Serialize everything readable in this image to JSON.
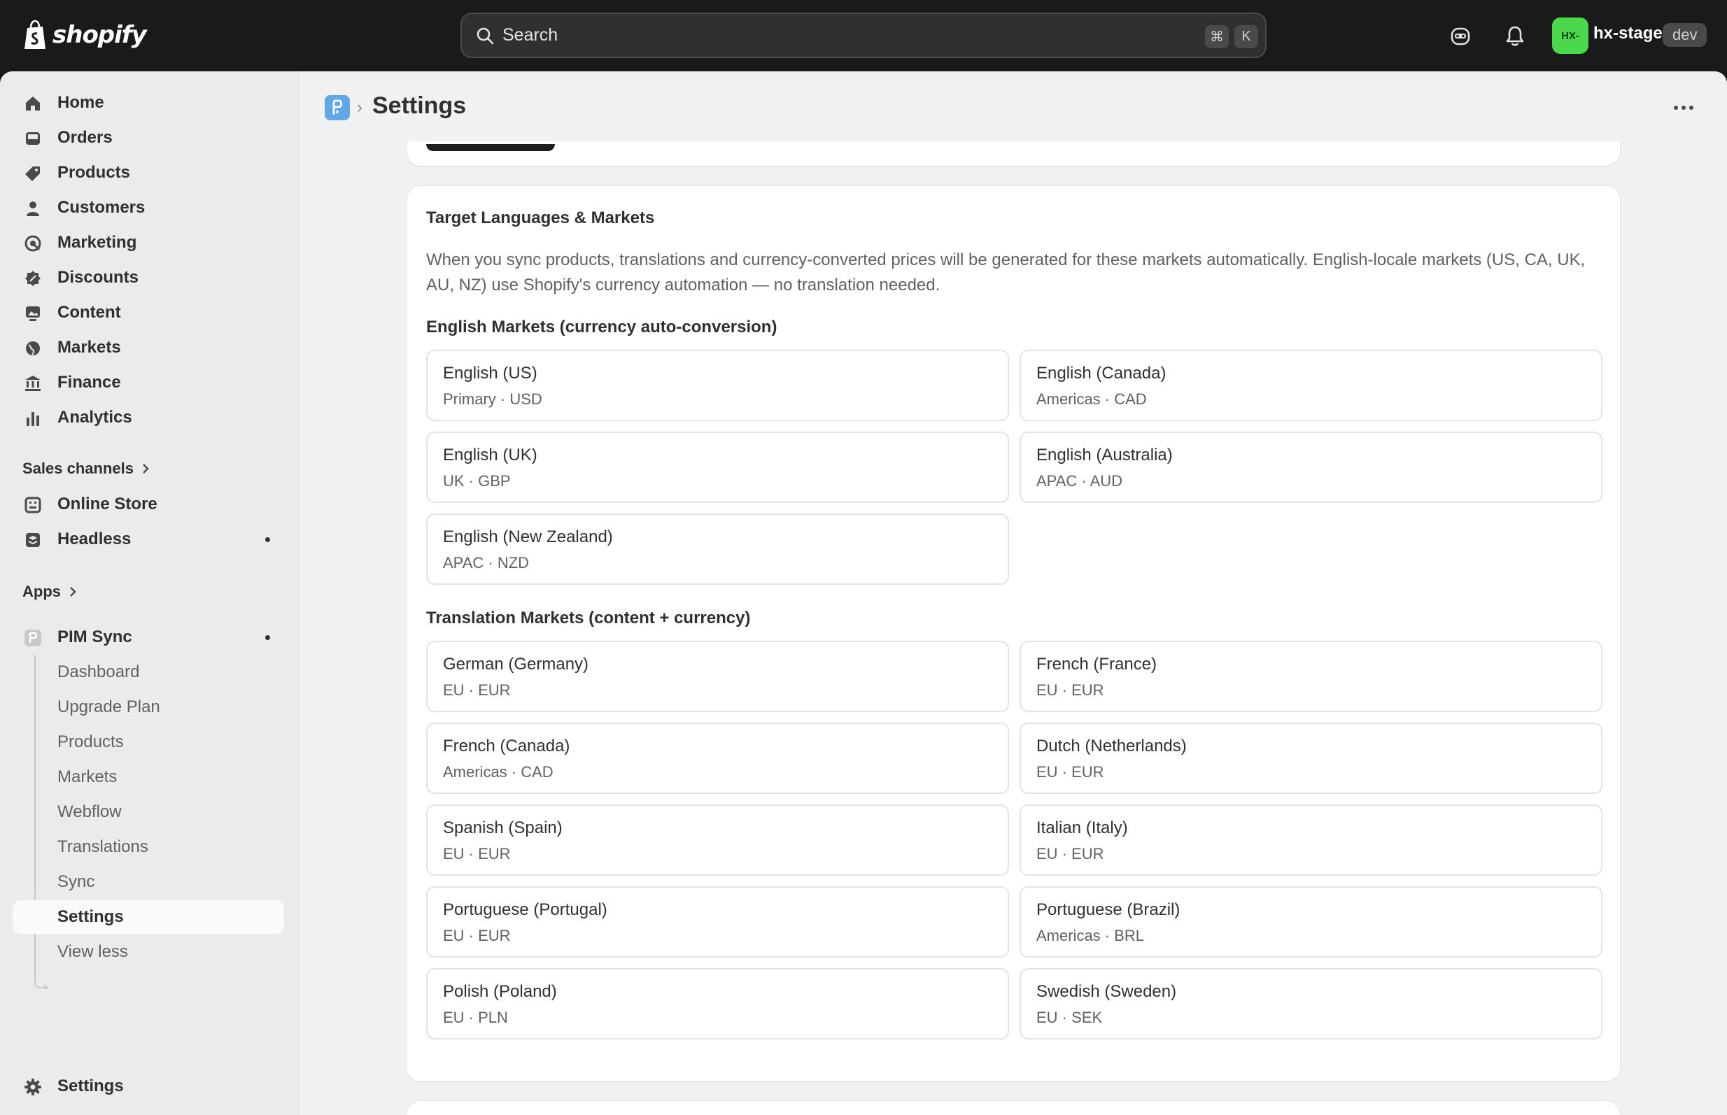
{
  "topbar": {
    "brand": "shopify",
    "search_placeholder": "Search",
    "shortcut_cmd": "⌘",
    "shortcut_key": "K",
    "avatar_initials": "HX-",
    "store_name": "hx-stage",
    "env_badge": "dev"
  },
  "sidebar": {
    "items": [
      {
        "label": "Home",
        "icon": "home-icon"
      },
      {
        "label": "Orders",
        "icon": "inbox-icon"
      },
      {
        "label": "Products",
        "icon": "tag-icon"
      },
      {
        "label": "Customers",
        "icon": "person-icon"
      },
      {
        "label": "Marketing",
        "icon": "target-icon"
      },
      {
        "label": "Discounts",
        "icon": "discount-icon"
      },
      {
        "label": "Content",
        "icon": "image-icon"
      },
      {
        "label": "Markets",
        "icon": "globe-icon"
      },
      {
        "label": "Finance",
        "icon": "bank-icon"
      },
      {
        "label": "Analytics",
        "icon": "bar-chart-icon"
      }
    ],
    "sales_channels_label": "Sales channels",
    "channels": [
      {
        "label": "Online Store",
        "icon": "store-icon"
      },
      {
        "label": "Headless",
        "icon": "layers-icon"
      }
    ],
    "apps_label": "Apps",
    "app": {
      "label": "PIM Sync",
      "icon": "pim-sync-app-icon"
    },
    "app_subitems": [
      "Dashboard",
      "Upgrade Plan",
      "Products",
      "Markets",
      "Webflow",
      "Translations",
      "Sync",
      "Settings",
      "View less"
    ],
    "settings_label": "Settings"
  },
  "header": {
    "title": "Settings"
  },
  "target_card": {
    "title": "Target Languages & Markets",
    "description": "When you sync products, translations and currency-converted prices will be generated for these markets automatically. English-locale markets (US, CA, UK, AU, NZ) use Shopify's currency automation — no translation needed.",
    "english_section_title": "English Markets (currency auto-conversion)",
    "english_markets": [
      {
        "name": "English (US)",
        "meta": "Primary · USD"
      },
      {
        "name": "English (Canada)",
        "meta": "Americas · CAD"
      },
      {
        "name": "English (UK)",
        "meta": "UK · GBP"
      },
      {
        "name": "English (Australia)",
        "meta": "APAC · AUD"
      },
      {
        "name": "English (New Zealand)",
        "meta": "APAC · NZD"
      }
    ],
    "translation_section_title": "Translation Markets (content + currency)",
    "translation_markets": [
      {
        "name": "German (Germany)",
        "meta": "EU · EUR"
      },
      {
        "name": "French (France)",
        "meta": "EU · EUR"
      },
      {
        "name": "French (Canada)",
        "meta": "Americas · CAD"
      },
      {
        "name": "Dutch (Netherlands)",
        "meta": "EU · EUR"
      },
      {
        "name": "Spanish (Spain)",
        "meta": "EU · EUR"
      },
      {
        "name": "Italian (Italy)",
        "meta": "EU · EUR"
      },
      {
        "name": "Portuguese (Portugal)",
        "meta": "EU · EUR"
      },
      {
        "name": "Portuguese (Brazil)",
        "meta": "Americas · BRL"
      },
      {
        "name": "Polish (Poland)",
        "meta": "EU · PLN"
      },
      {
        "name": "Swedish (Sweden)",
        "meta": "EU · SEK"
      }
    ]
  }
}
